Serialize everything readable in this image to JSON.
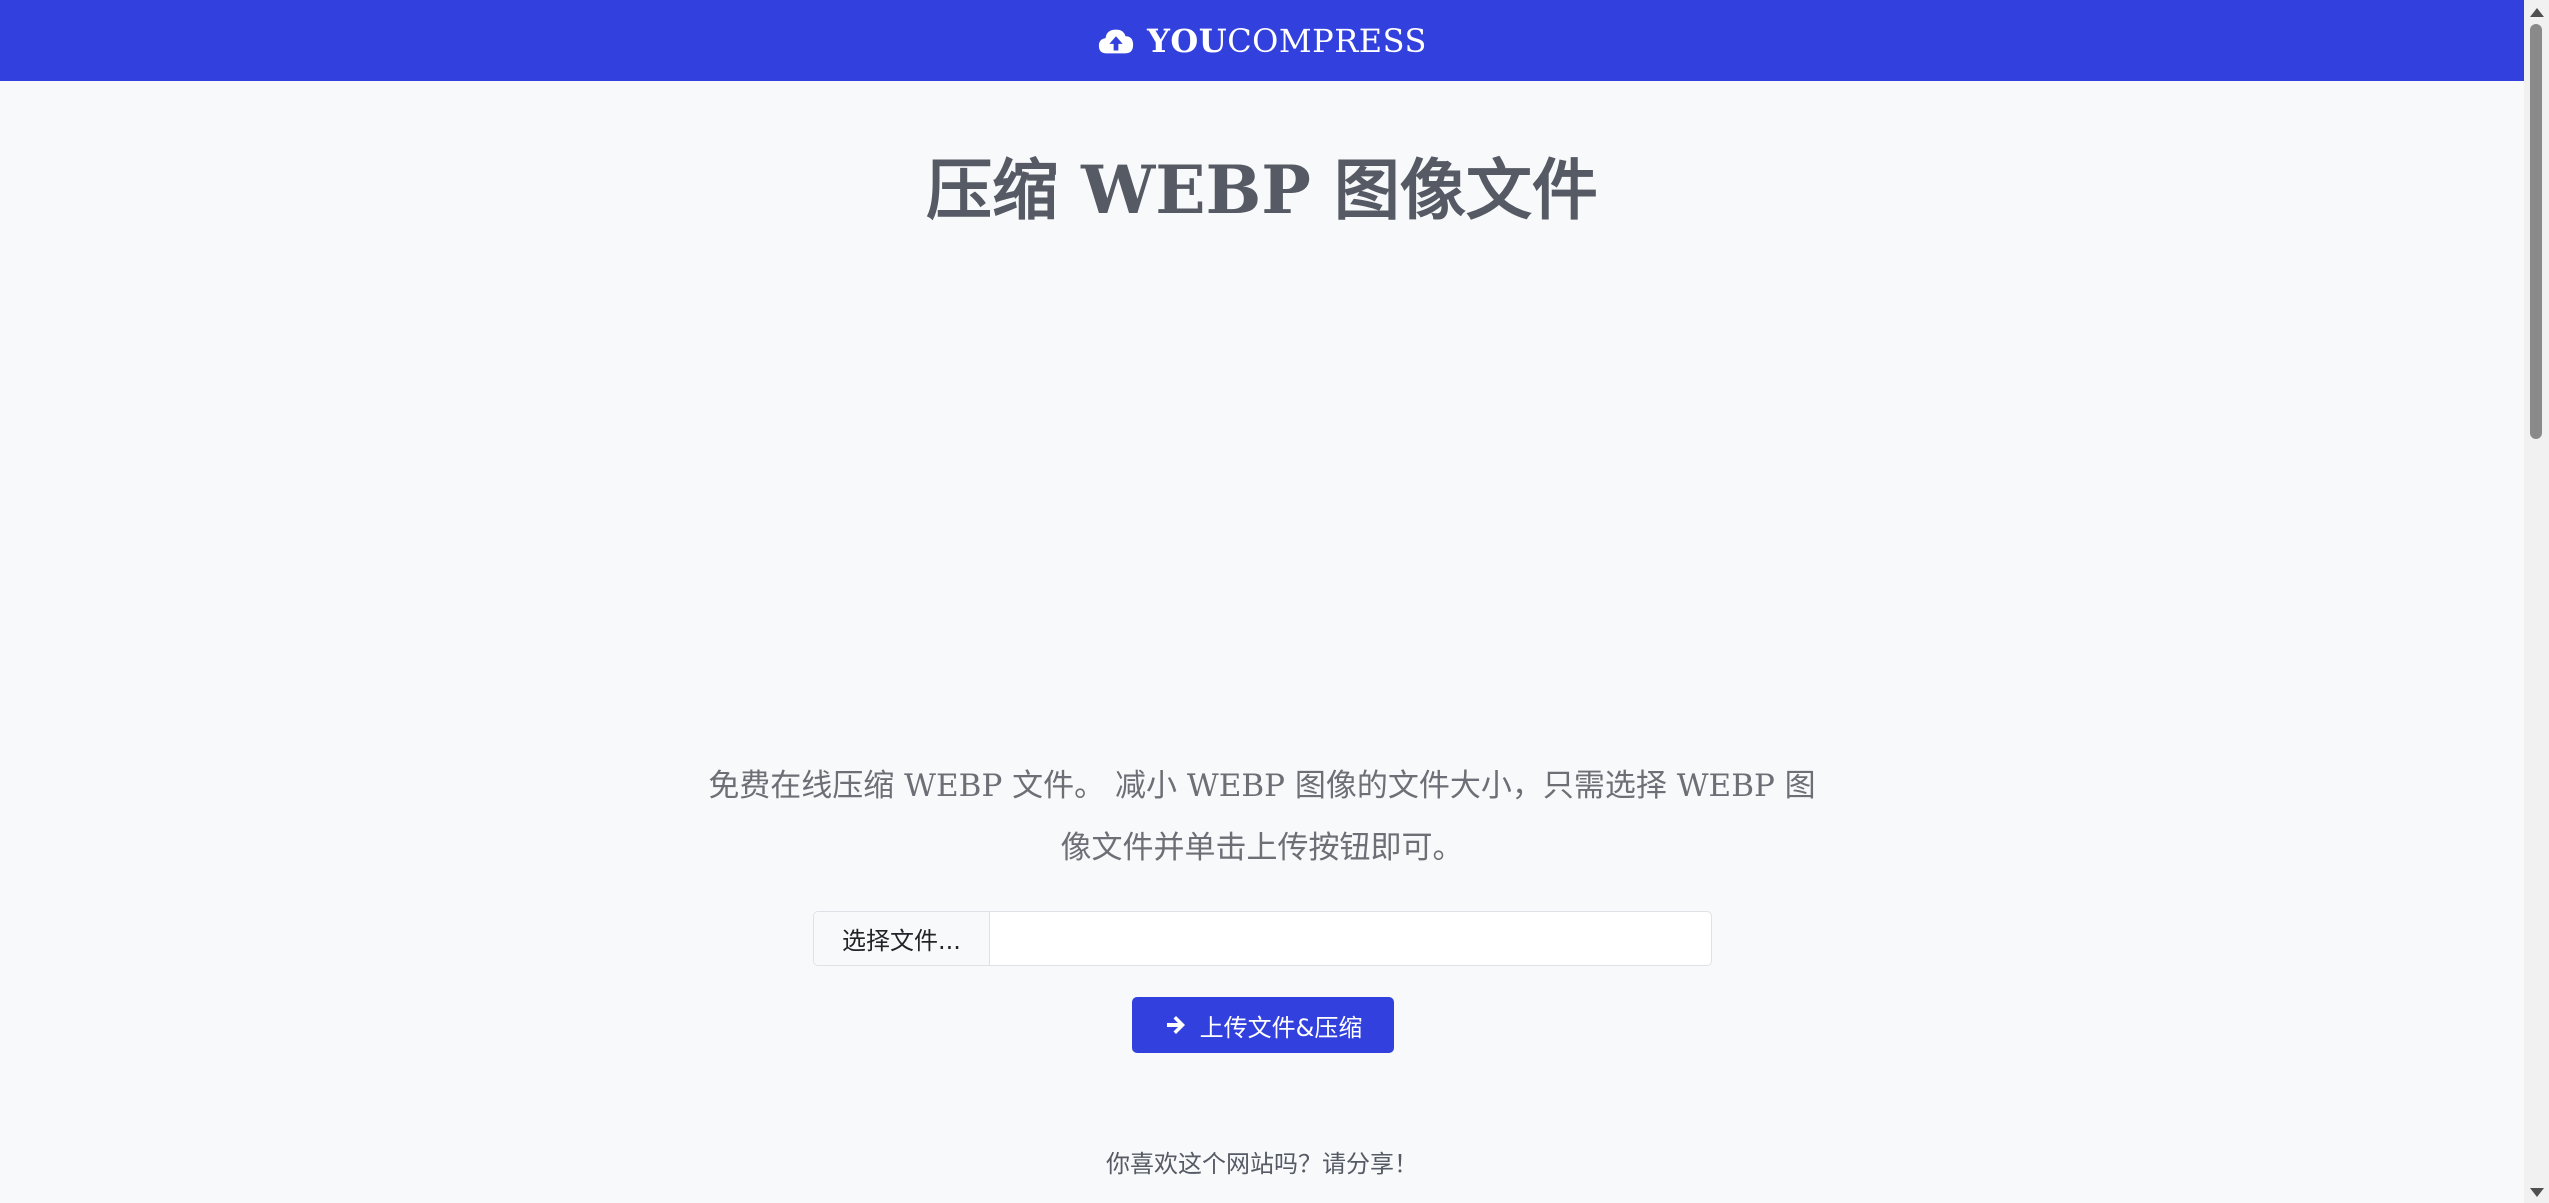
{
  "header": {
    "brand_bold": "YOU",
    "brand_light": "COMPRESS",
    "brand_icon": "cloud-upload-icon",
    "background_color": "#3240de"
  },
  "main": {
    "title": "压缩 WEBP 图像文件",
    "description": "免费在线压缩 WEBP 文件。 减小 WEBP 图像的文件大小，只需选择 WEBP 图像文件并单击上传按钮即可。",
    "file_input": {
      "button_label": "选择文件...",
      "file_name": ""
    },
    "upload_button": {
      "label": "上传文件&压缩",
      "icon": "arrow-right-icon"
    },
    "share_text": "你喜欢这个网站吗？请分享！"
  },
  "colors": {
    "accent": "#3240de",
    "title": "#555a64",
    "text": "#6c6f75",
    "page_bg": "#f8f9fa"
  }
}
